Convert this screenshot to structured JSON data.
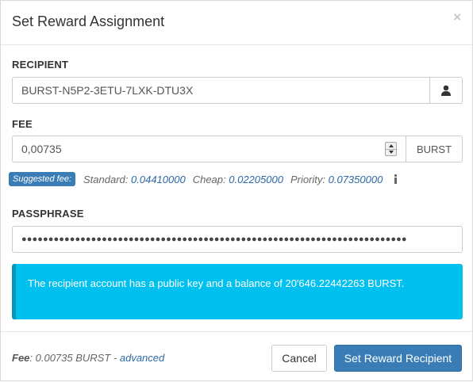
{
  "modal": {
    "title": "Set Reward Assignment",
    "close_glyph": "×"
  },
  "recipient": {
    "label": "RECIPIENT",
    "value": "BURST-N5P2-3ETU-7LXK-DTU3X",
    "button_icon": "user-icon"
  },
  "fee": {
    "label": "FEE",
    "value": "0,00735",
    "unit": "BURST"
  },
  "suggested_fee": {
    "badge": "Suggested fee:",
    "standard_label": "Standard:",
    "standard_value": "0.04410000",
    "cheap_label": "Cheap:",
    "cheap_value": "0.02205000",
    "priority_label": "Priority:",
    "priority_value": "0.07350000",
    "info_icon": "info-icon"
  },
  "passphrase": {
    "label": "PASSPHRASE",
    "masked_value": "●●●●●●●●●●●●●●●●●●●●●●●●●●●●●●●●●●●●●●●●●●●●●●●●●●●●●●●●●●●●●●●●●●●●●●●●"
  },
  "alert": {
    "message": "The recipient account has a public key and a balance of 20'646.22442263 BURST."
  },
  "footer": {
    "fee_label": "Fee",
    "fee_text": ": 0.00735 BURST - ",
    "advanced_link": "advanced",
    "cancel_label": "Cancel",
    "submit_label": "Set Reward Recipient"
  },
  "colors": {
    "primary": "#3a7cb5",
    "alert_bg": "#00c0ef",
    "alert_border": "#0397bb",
    "link": "#2a6aa8"
  }
}
